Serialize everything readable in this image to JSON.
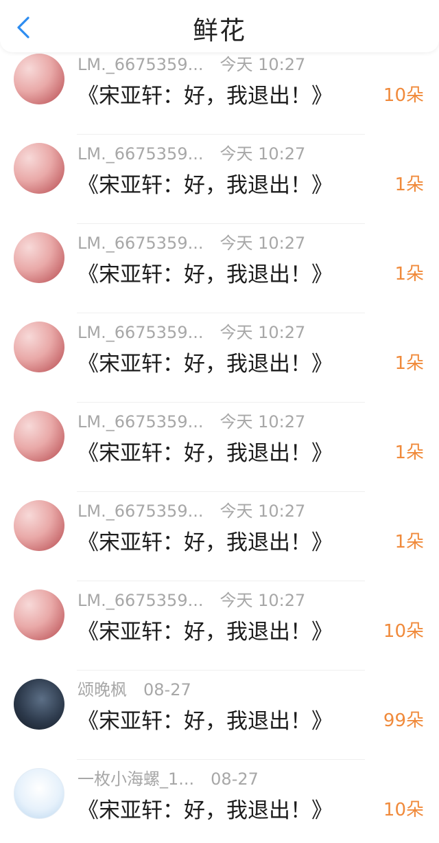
{
  "header": {
    "title": "鲜花"
  },
  "rows": [
    {
      "user": "LM._6675359...",
      "time": "今天 10:27",
      "title": "《宋亚轩：好，我退出！》",
      "count": "10朵",
      "avatar": "pink"
    },
    {
      "user": "LM._6675359...",
      "time": "今天 10:27",
      "title": "《宋亚轩：好，我退出！》",
      "count": "1朵",
      "avatar": "pink"
    },
    {
      "user": "LM._6675359...",
      "time": "今天 10:27",
      "title": "《宋亚轩：好，我退出！》",
      "count": "1朵",
      "avatar": "pink"
    },
    {
      "user": "LM._6675359...",
      "time": "今天 10:27",
      "title": "《宋亚轩：好，我退出！》",
      "count": "1朵",
      "avatar": "pink"
    },
    {
      "user": "LM._6675359...",
      "time": "今天 10:27",
      "title": "《宋亚轩：好，我退出！》",
      "count": "1朵",
      "avatar": "pink"
    },
    {
      "user": "LM._6675359...",
      "time": "今天 10:27",
      "title": "《宋亚轩：好，我退出！》",
      "count": "1朵",
      "avatar": "pink"
    },
    {
      "user": "LM._6675359...",
      "time": "今天 10:27",
      "title": "《宋亚轩：好，我退出！》",
      "count": "10朵",
      "avatar": "pink"
    },
    {
      "user": "颂晚枫",
      "time": "08-27",
      "title": "《宋亚轩：好，我退出！》",
      "count": "99朵",
      "avatar": "dark"
    },
    {
      "user": "一枚小海螺_1...",
      "time": "08-27",
      "title": "《宋亚轩：好，我退出！》",
      "count": "10朵",
      "avatar": "light"
    }
  ],
  "colors": {
    "accent": "#f08a3b",
    "back_icon": "#2d8cf0",
    "meta_text": "#a7a7a7"
  },
  "icons": {
    "back": "chevron-left-icon"
  }
}
